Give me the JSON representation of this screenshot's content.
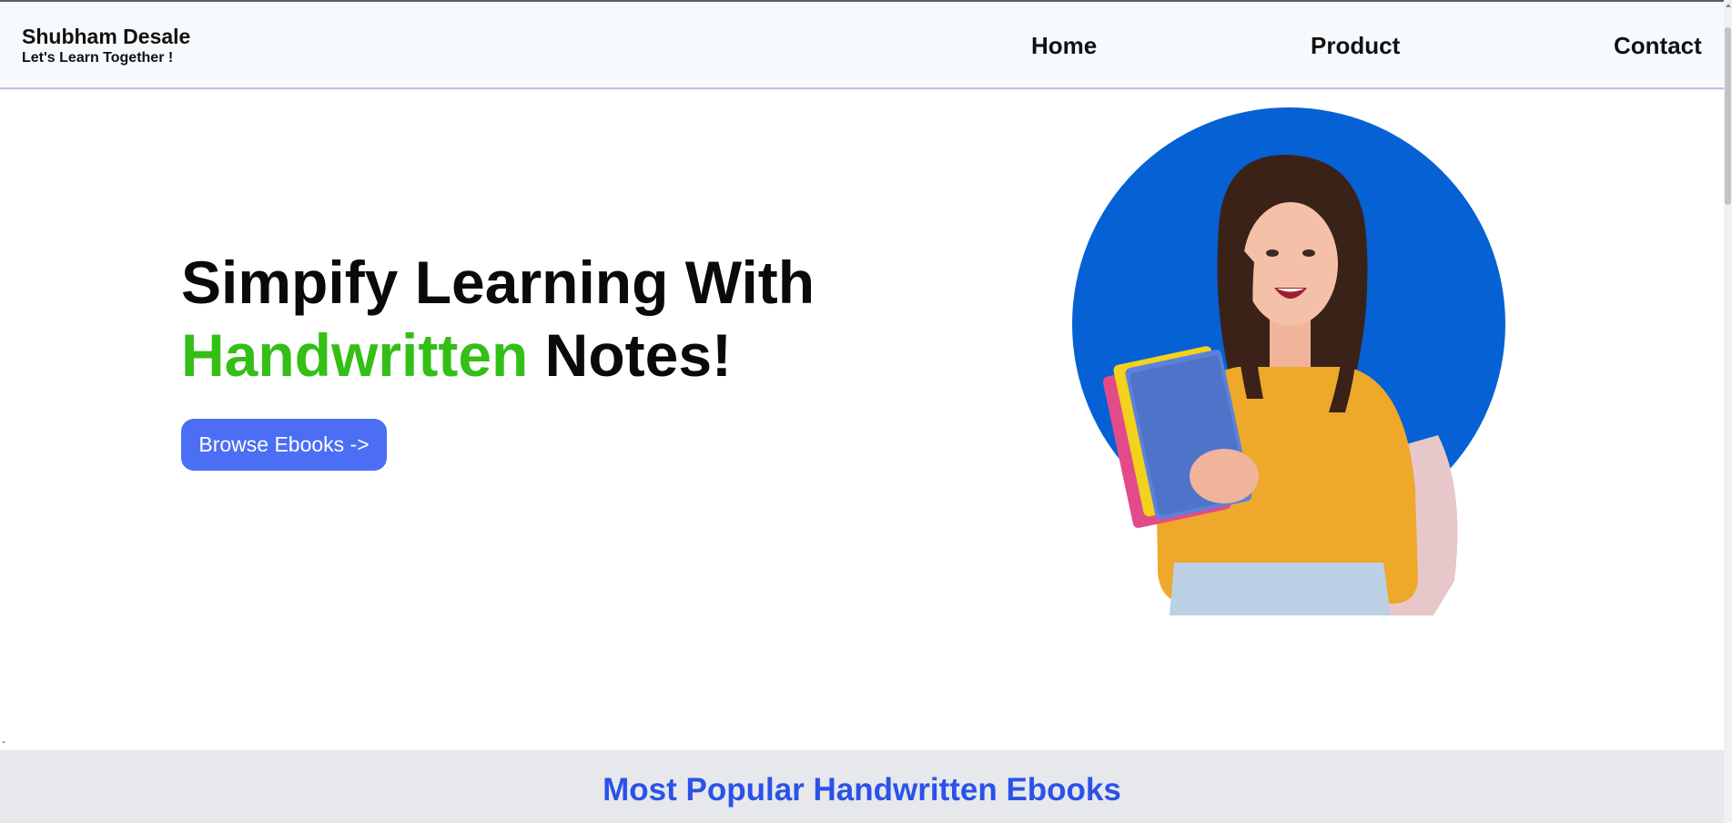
{
  "header": {
    "brand_name": "Shubham Desale",
    "tagline": "Let's Learn Together !",
    "nav": [
      {
        "label": "Home"
      },
      {
        "label": "Product"
      },
      {
        "label": "Contact"
      }
    ]
  },
  "hero": {
    "title_line1": "Simpify Learning With",
    "title_accent": "Handwritten",
    "title_rest": " Notes!",
    "cta_label": "Browse Ebooks ->"
  },
  "stray_text": ".",
  "popular": {
    "heading": "Most Popular Handwritten Ebooks"
  },
  "colors": {
    "accent_green": "#33bf16",
    "button_blue": "#4c6ef5",
    "circle_blue": "#0561d4",
    "heading_blue": "#2b52e8",
    "sweater_orange": "#eea82a"
  }
}
